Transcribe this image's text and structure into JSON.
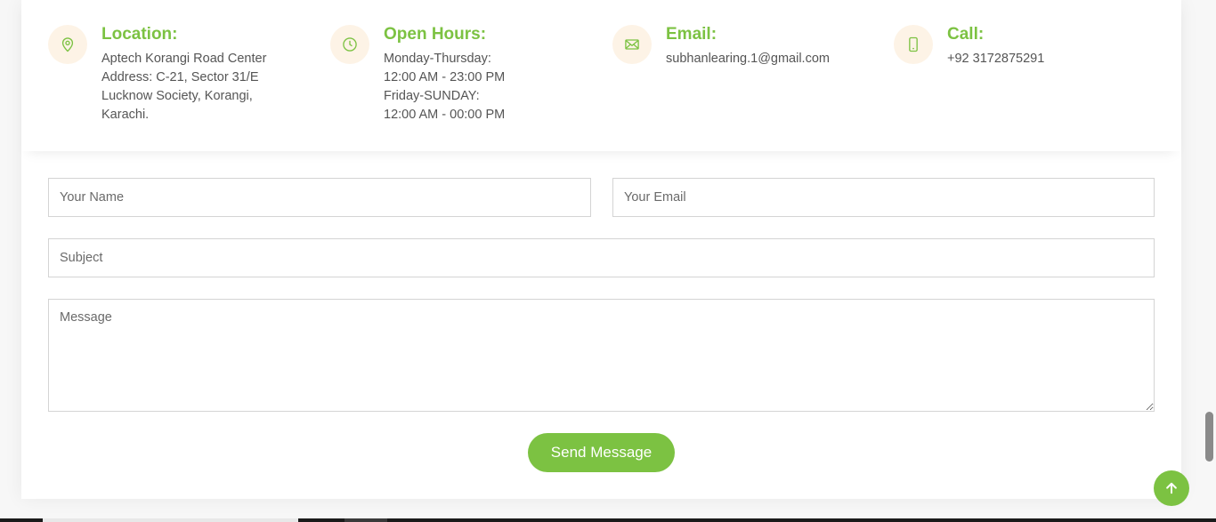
{
  "info": {
    "location": {
      "icon": "map-pin-icon",
      "title": "Location:",
      "lines": [
        "Aptech Korangi Road Center",
        "Address: C-21, Sector 31/E",
        "Lucknow Society, Korangi,",
        "Karachi."
      ]
    },
    "hours": {
      "icon": "clock-icon",
      "title": "Open Hours:",
      "lines": [
        "Monday-Thursday:",
        "12:00 AM - 23:00 PM",
        "Friday-SUNDAY:",
        "12:00 AM - 00:00 PM"
      ]
    },
    "email": {
      "icon": "envelope-icon",
      "title": "Email:",
      "lines": [
        "subhanlearing.1@gmail.com"
      ]
    },
    "call": {
      "icon": "phone-icon",
      "title": "Call:",
      "lines": [
        "+92 3172875291"
      ]
    }
  },
  "form": {
    "name_placeholder": "Your Name",
    "email_placeholder": "Your Email",
    "subject_placeholder": "Subject",
    "message_placeholder": "Message",
    "submit_label": "Send Message"
  },
  "back_to_top": {
    "icon": "arrow-up-icon"
  },
  "colors": {
    "accent": "#7cc242",
    "icon_bg": "#fdf3e6",
    "text": "#555555",
    "border": "#d4d4d4"
  }
}
